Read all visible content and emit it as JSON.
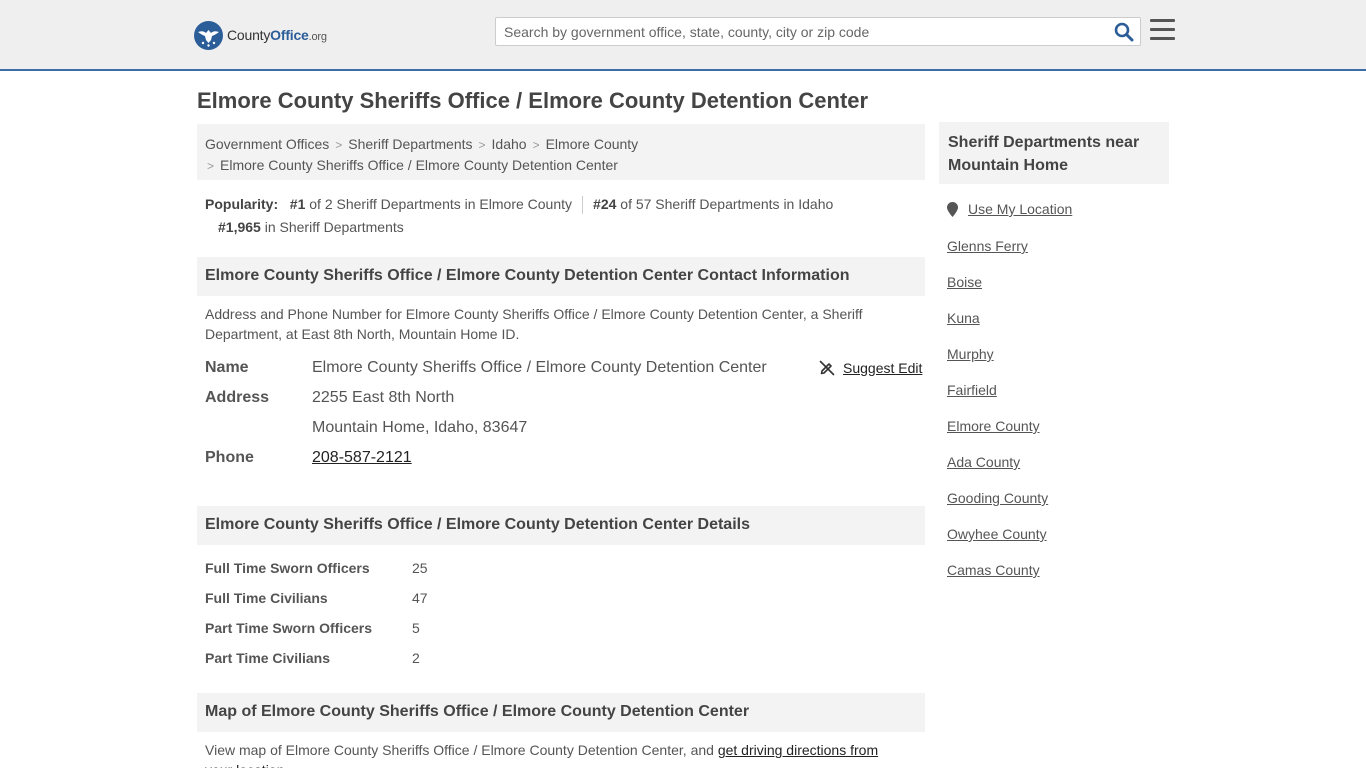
{
  "header": {
    "logo_main": "County",
    "logo_bold": "Office",
    "logo_org": ".org",
    "search_placeholder": "Search by government office, state, county, city or zip code"
  },
  "page": {
    "title": "Elmore County Sheriffs Office / Elmore County Detention Center"
  },
  "breadcrumb": {
    "items": [
      "Government Offices",
      "Sheriff Departments",
      "Idaho",
      "Elmore County"
    ],
    "current": "Elmore County Sheriffs Office / Elmore County Detention Center"
  },
  "popularity": {
    "label": "Popularity:",
    "rank1": "#1",
    "rank1_text": "of 2 Sheriff Departments in Elmore County",
    "rank2": "#24",
    "rank2_text": "of 57 Sheriff Departments in Idaho",
    "rank3": "#1,965",
    "rank3_text": "in Sheriff Departments"
  },
  "contact": {
    "heading": "Elmore County Sheriffs Office / Elmore County Detention Center Contact Information",
    "description": "Address and Phone Number for Elmore County Sheriffs Office / Elmore County Detention Center, a Sheriff Department, at East 8th North, Mountain Home ID.",
    "name_label": "Name",
    "name_value": "Elmore County Sheriffs Office / Elmore County Detention Center",
    "suggest_edit": "Suggest Edit",
    "address_label": "Address",
    "address_line1": "2255 East 8th North",
    "address_line2": "Mountain Home, Idaho, 83647",
    "phone_label": "Phone",
    "phone_value": "208-587-2121"
  },
  "details": {
    "heading": "Elmore County Sheriffs Office / Elmore County Detention Center Details",
    "rows": [
      {
        "label": "Full Time Sworn Officers",
        "value": "25"
      },
      {
        "label": "Full Time Civilians",
        "value": "47"
      },
      {
        "label": "Part Time Sworn Officers",
        "value": "5"
      },
      {
        "label": "Part Time Civilians",
        "value": "2"
      }
    ]
  },
  "map": {
    "heading": "Map of Elmore County Sheriffs Office / Elmore County Detention Center",
    "description_prefix": "View map of Elmore County Sheriffs Office / Elmore County Detention Center, and ",
    "description_link": "get driving directions from your location"
  },
  "sidebar": {
    "heading": "Sheriff Departments near Mountain Home",
    "use_location": "Use My Location",
    "links": [
      "Glenns Ferry",
      "Boise",
      "Kuna",
      "Murphy",
      "Fairfield",
      "Elmore County",
      "Ada County",
      "Gooding County",
      "Owyhee County",
      "Camas County"
    ]
  },
  "colors": {
    "brand": "#2b5d99",
    "header_bg": "#efefef",
    "section_bg": "#f3f3f3"
  }
}
